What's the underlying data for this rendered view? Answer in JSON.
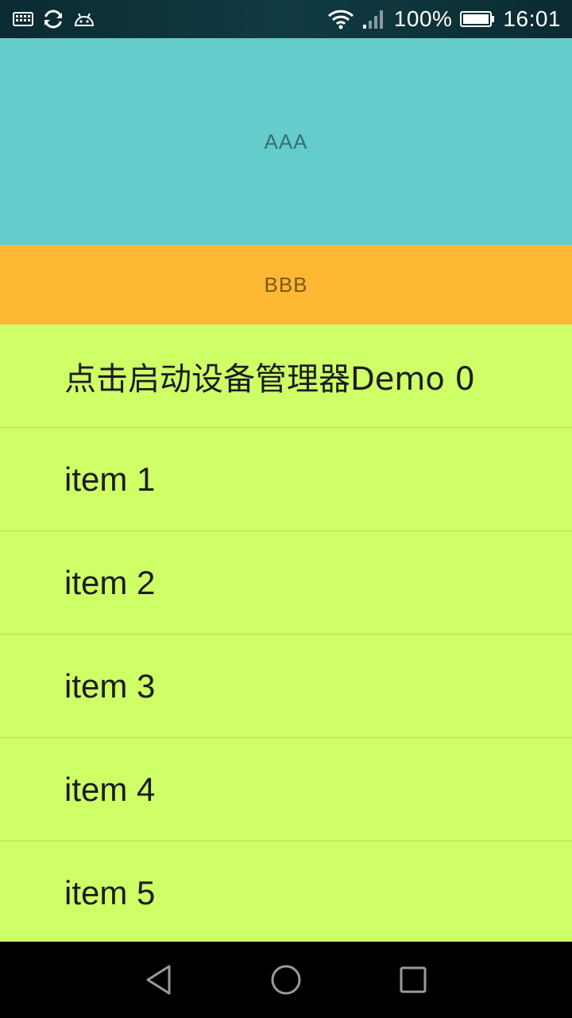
{
  "status_bar": {
    "icons_left": [
      "keyboard-icon",
      "sync-icon",
      "android-icon"
    ],
    "icons_right": [
      "wifi-icon",
      "signal-icon",
      "battery-icon"
    ],
    "battery_level": "100%",
    "time": "16:01"
  },
  "header": {
    "label": "AAA",
    "color": "#64cccb"
  },
  "bar": {
    "label": "BBB",
    "color": "#ffb834"
  },
  "list": {
    "color": "#cfff67",
    "items": [
      {
        "label": "点击启动设备管理器Demo 0"
      },
      {
        "label": "item 1"
      },
      {
        "label": "item 2"
      },
      {
        "label": "item 3"
      },
      {
        "label": "item 4"
      },
      {
        "label": "item 5"
      }
    ]
  },
  "nav_bar": {
    "buttons": [
      "back-icon",
      "home-icon",
      "recent-apps-icon"
    ]
  }
}
